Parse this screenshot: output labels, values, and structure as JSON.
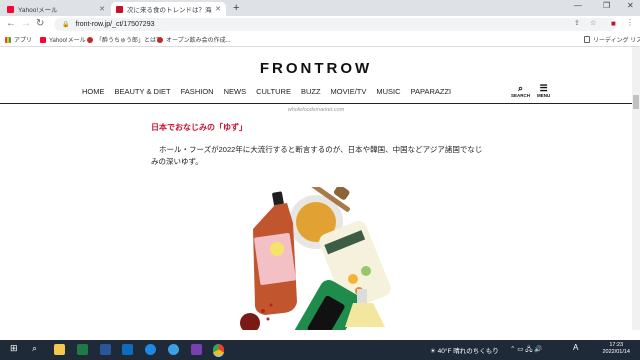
{
  "browser": {
    "tabs": [
      {
        "title": "Yahoo!メール",
        "active": false,
        "favicon_color": "#ff0033"
      },
      {
        "title": "次に来る食のトレンドは？海外の大",
        "active": true,
        "favicon_color": "#c8102e"
      }
    ],
    "new_tab": "+",
    "window_controls": {
      "minimize": "—",
      "restore": "❐",
      "close": "✕"
    },
    "url": "front-row.jp/_ct/17507293"
  },
  "bookmarks": [
    {
      "label": "アプリ"
    },
    {
      "label": "Yahoo!メール"
    },
    {
      "label": "「酔うちゅう郎」とは？"
    },
    {
      "label": "オープン飲み会の作成..."
    }
  ],
  "reading_list": "リーディング リスト",
  "site": {
    "logo": "FRONTROW",
    "nav": [
      "HOME",
      "BEAUTY & DIET",
      "FASHION",
      "NEWS",
      "CULTURE",
      "BUZZ",
      "MOVIE/TV",
      "MUSIC",
      "PAPARAZZI"
    ],
    "search_label": "SEARCH",
    "menu_label": "MENU",
    "caption": "wholefoodsmarket.com",
    "heading": "日本でおなじみの「ゆず」",
    "paragraph": "ホール・フーズが2022年に大流行すると断言するのが、日本や韓国、中国などアジア諸国でなじみの深いゆず。"
  },
  "taskbar": {
    "weather": "40°F 晴れのちくもり",
    "ime": "A",
    "time": "17:23",
    "date": "2022/01/14"
  }
}
